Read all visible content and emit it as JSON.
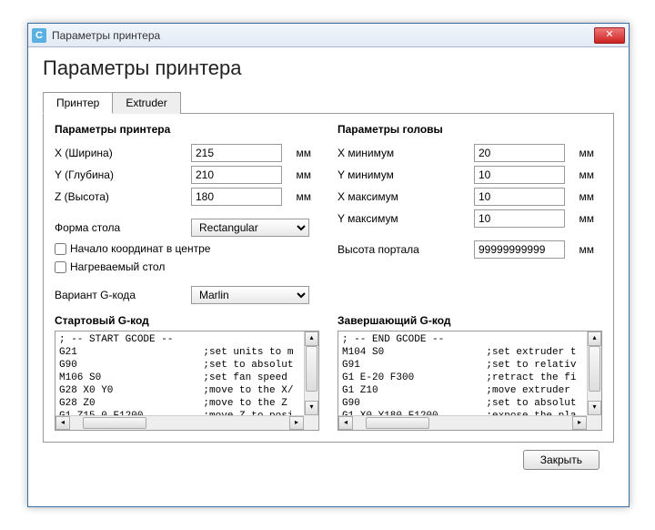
{
  "window": {
    "title": "Параметры принтера"
  },
  "heading": "Параметры принтера",
  "tabs": {
    "printer": "Принтер",
    "extruder": "Extruder"
  },
  "left": {
    "head": "Параметры принтера",
    "x_label": "X (Ширина)",
    "x_val": "215",
    "y_label": "Y (Глубина)",
    "y_val": "210",
    "z_label": "Z (Высота)",
    "z_val": "180",
    "unit": "мм",
    "shape_label": "Форма стола",
    "shape_val": "Rectangular",
    "origin_center": "Начало координат в центре",
    "heated_bed": "Нагреваемый стол",
    "gcode_flavor_label": "Вариант G-кода",
    "gcode_flavor_val": "Marlin"
  },
  "right": {
    "head": "Параметры головы",
    "xmin_label": "X минимум",
    "xmin_val": "20",
    "ymin_label": "Y минимум",
    "ymin_val": "10",
    "xmax_label": "X максимум",
    "xmax_val": "10",
    "ymax_label": "Y максимум",
    "ymax_val": "10",
    "unit": "мм",
    "gantry_label": "Высота портала",
    "gantry_val": "99999999999"
  },
  "start_gcode": {
    "head": "Стартовый G-код",
    "text": "; -- START GCODE --\nG21                     ;set units to m\nG90                     ;set to absolut\nM106 S0                 ;set fan speed \nG28 X0 Y0               ;move to the X/\nG28 Z0                  ;move to the Z \nG1 Z15.0 F1200          ;move Z to posi"
  },
  "end_gcode": {
    "head": "Завершающий G-код",
    "text": "; -- END GCODE --\nM104 S0                 ;set extruder t\nG91                     ;set to relativ\nG1 E-20 F300            ;retract the fi\nG1 Z10                  ;move extruder \nG90                     ;set to absolut\nG1 X0 Y180 F1200        ;expose the pla"
  },
  "footer": {
    "close": "Закрыть"
  }
}
